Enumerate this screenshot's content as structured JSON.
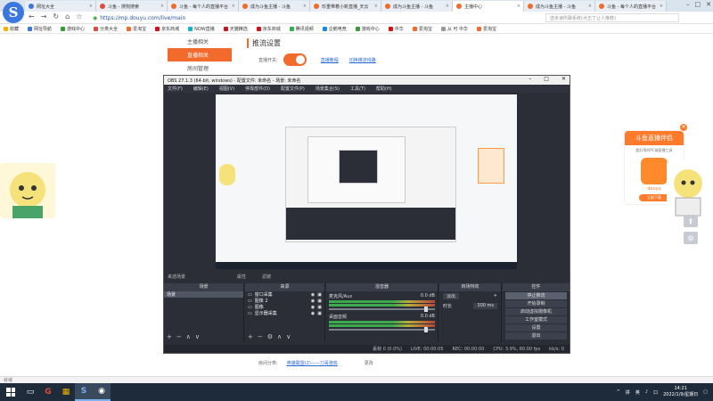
{
  "browser": {
    "tabs": [
      {
        "label": "网址大全",
        "color": "#3a78e0",
        "active": false
      },
      {
        "label": "斗鱼 - 搜狗搜索",
        "color": "#e04a3a",
        "active": false
      },
      {
        "label": "斗鱼 - 每个人的直播平台",
        "color": "#f36b2c",
        "active": false
      },
      {
        "label": "成为斗鱼主播 - 斗鱼",
        "color": "#f36b2c",
        "active": false
      },
      {
        "label": "珍重带着小新直播_天云",
        "color": "#f36b2c",
        "active": false
      },
      {
        "label": "成为斗鱼主播 - 斗鱼",
        "color": "#f36b2c",
        "active": false
      },
      {
        "label": "主播中心",
        "color": "#f36b2c",
        "active": true
      },
      {
        "label": "成为斗鱼主播 - 斗鱼",
        "color": "#f36b2c",
        "active": false
      },
      {
        "label": "斗鱼 - 每个人的直播平台",
        "color": "#f36b2c",
        "active": false
      }
    ],
    "url": "https://mp.douyu.com/live/main",
    "search_placeholder": "选未读所聊系统(点击了让人推荐)",
    "bookmarks": [
      {
        "label": "收藏",
        "color": "#f2b400"
      },
      {
        "label": "网址导航",
        "color": "#3a78e0"
      },
      {
        "label": "游戏中心",
        "color": "#3a9a3a"
      },
      {
        "label": "分类大全",
        "color": "#e04a3a"
      },
      {
        "label": "爱淘宝",
        "color": "#f36b2c"
      },
      {
        "label": "京东商城",
        "color": "#d0121b"
      },
      {
        "label": "NOW直播",
        "color": "#12b3d0"
      },
      {
        "label": "天猫精选",
        "color": "#d0121b"
      },
      {
        "label": "京东商城",
        "color": "#d0121b"
      },
      {
        "label": "腾讯视频",
        "color": "#2ab34a"
      },
      {
        "label": "企鹅电竞",
        "color": "#1e88e5"
      },
      {
        "label": "游戏中心",
        "color": "#3a9a3a"
      },
      {
        "label": "中华",
        "color": "#d0121b"
      },
      {
        "label": "爱淘宝",
        "color": "#f36b2c"
      },
      {
        "label": "从 可 中华",
        "color": "#999999"
      },
      {
        "label": "爱淘宝",
        "color": "#f36b2c"
      }
    ]
  },
  "page": {
    "nav": [
      {
        "label": "主播相关",
        "active": false
      },
      {
        "label": "直播相关",
        "active": true
      },
      {
        "label": "房间管理",
        "active": false
      }
    ],
    "settings_title": "推流设置",
    "live_switch_label": "直播开关:",
    "link_tutorial": "直播教程",
    "link_switch_line": "切换推流线路",
    "footer_label": "房间分类:",
    "footer_link": "英雄联盟(2)——刀哥游戏",
    "footer_change": "更改",
    "status_text": "就绪"
  },
  "ad": {
    "title": "斗鱼直播伴侣",
    "subtitle": "超好用的PC端直播工具",
    "app_label": "douyu",
    "button": "立即下载"
  },
  "obs": {
    "title": "OBS 27.1.3 (64-bit, windows) - 配置文件: 未命名 - 场景: 未命名",
    "menu": [
      "文件(F)",
      "编辑(E)",
      "视图(V)",
      "停靠部件(D)",
      "配置文件(P)",
      "场景集合(S)",
      "工具(T)",
      "帮助(H)"
    ],
    "preview_toolbar": [
      "来选场景",
      "属性",
      "滤镜"
    ],
    "docks": {
      "scenes": {
        "title": "场景",
        "items": [
          "场景"
        ]
      },
      "sources": {
        "title": "来源",
        "items": [
          "窗口采集",
          "图像 2",
          "图像",
          "显示器采集"
        ]
      },
      "mixer": {
        "title": "混音器",
        "channels": [
          {
            "name": "麦克风/Aux",
            "db": "0.0 dB"
          },
          {
            "name": "桌面音频",
            "db": "0.0 dB"
          }
        ]
      },
      "transitions": {
        "title": "转场特效",
        "type": "淡出",
        "duration_label": "时长",
        "duration": "300 ms"
      },
      "controls": {
        "title": "控件",
        "buttons": [
          "停止推流",
          "开始录制",
          "启动虚拟摄像机",
          "工作室模式",
          "设置",
          "退出"
        ]
      }
    },
    "status": {
      "dropped": "丢帧 0 (0.0%)",
      "live": "LIVE: 00:00:05",
      "rec": "REC: 00:00:00",
      "cpu": "CPU: 3.9%, 60.00 fps",
      "kbps": "kb/s: 0"
    }
  },
  "taskbar": {
    "time": "14:21",
    "date": "2022/1/9/星期日",
    "tray": [
      "^",
      "拼",
      "英",
      "口"
    ]
  }
}
